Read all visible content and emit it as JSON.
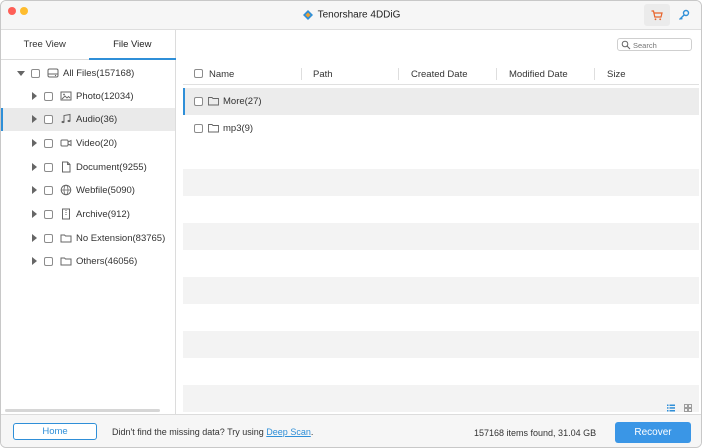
{
  "window": {
    "title": "Tenorshare 4DDiG"
  },
  "colors": {
    "accent": "#2f8fd8",
    "recover": "#3a96e6",
    "cart": "#e8632b"
  },
  "sidebar": {
    "tabs": [
      {
        "label": "Tree View",
        "active": false
      },
      {
        "label": "File View",
        "active": true
      }
    ],
    "tree": [
      {
        "label": "All Files(157168)",
        "icon": "drive-icon",
        "expanded": true,
        "level": 0
      },
      {
        "label": "Photo(12034)",
        "icon": "photo-icon",
        "level": 1
      },
      {
        "label": "Audio(36)",
        "icon": "audio-icon",
        "level": 1,
        "selected": true
      },
      {
        "label": "Video(20)",
        "icon": "video-icon",
        "level": 1
      },
      {
        "label": "Document(9255)",
        "icon": "document-icon",
        "level": 1
      },
      {
        "label": "Webfile(5090)",
        "icon": "globe-icon",
        "level": 1
      },
      {
        "label": "Archive(912)",
        "icon": "archive-icon",
        "level": 1
      },
      {
        "label": "No Extension(83765)",
        "icon": "folder-icon",
        "level": 1
      },
      {
        "label": "Others(46056)",
        "icon": "folder-icon",
        "level": 1
      }
    ]
  },
  "search": {
    "placeholder": "Search"
  },
  "table": {
    "columns": [
      "Name",
      "Path",
      "Created Date",
      "Modified Date",
      "Size"
    ],
    "rows": [
      {
        "name": "More(27)",
        "type": "folder",
        "selected": true
      },
      {
        "name": "mp3(9)",
        "type": "folder"
      }
    ]
  },
  "footer": {
    "home_label": "Home",
    "hint_text": "Didn't find the missing data? Try using ",
    "deep_scan_label": "Deep Scan",
    "hint_suffix": ".",
    "found_text": "157168 items found, 31.04 GB",
    "recover_label": "Recover"
  }
}
